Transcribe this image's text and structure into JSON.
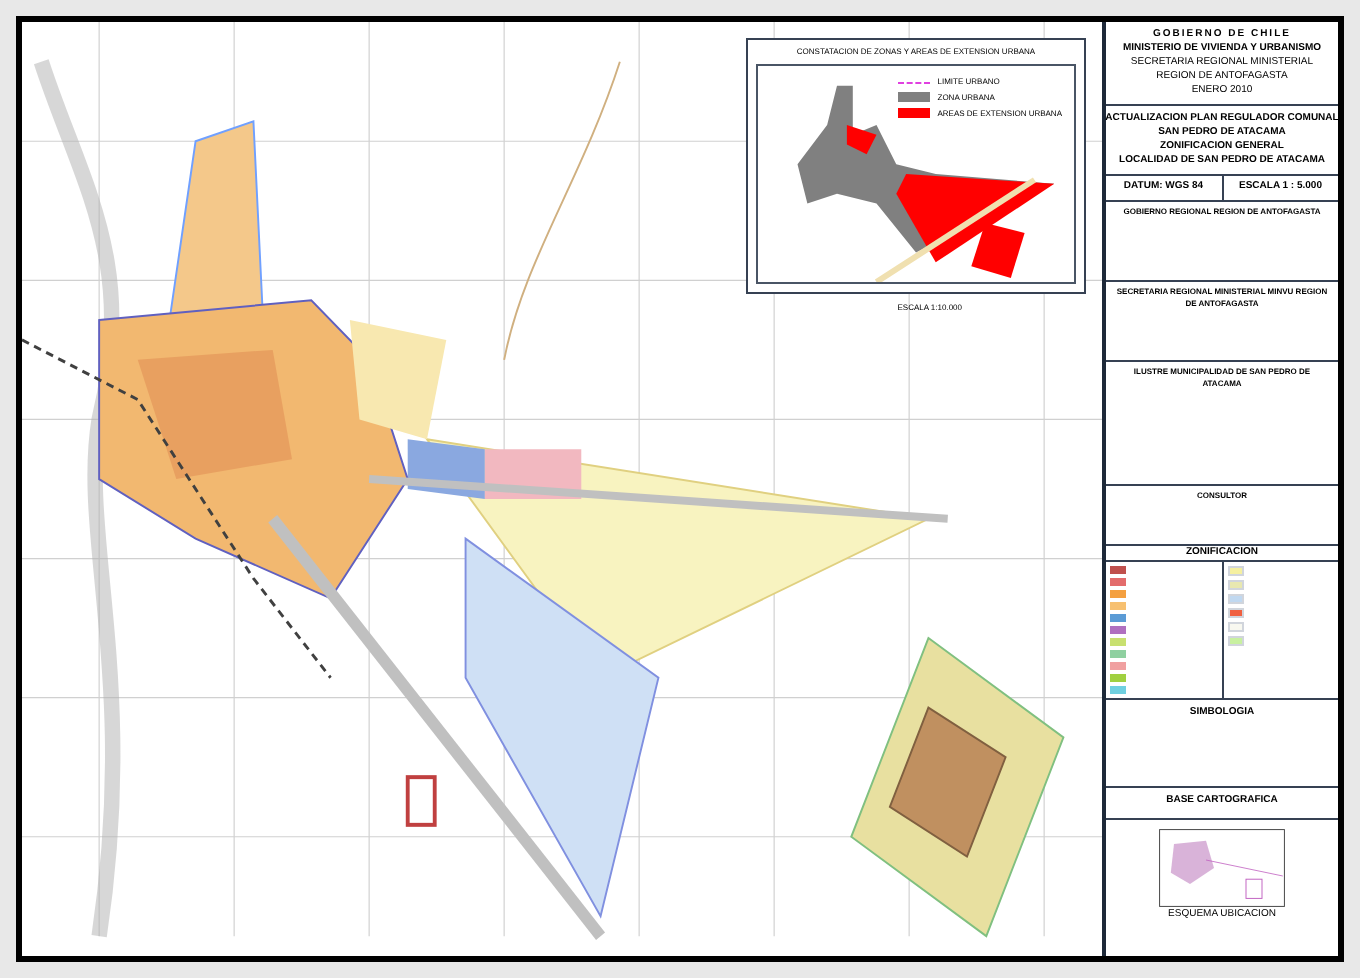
{
  "inset": {
    "title": "CONSTATACION DE ZONAS Y AREAS DE EXTENSION URBANA",
    "legend": [
      {
        "kind": "line",
        "label": "LIMITE URBANO",
        "color": "#e040e0"
      },
      {
        "kind": "fill",
        "label": "ZONA URBANA",
        "color": "#808080"
      },
      {
        "kind": "fill",
        "label": "AREAS DE EXTENSION URBANA",
        "color": "#ff0000"
      }
    ]
  },
  "scale_note": "ESCALA 1:10.000",
  "title_block": {
    "header": [
      "GOBIERNO DE CHILE",
      "MINISTERIO DE VIVIENDA Y URBANISMO",
      "SECRETARIA REGIONAL MINISTERIAL",
      "REGION DE ANTOFAGASTA",
      "ENERO 2010"
    ],
    "project": [
      "ACTUALIZACION PLAN REGULADOR COMUNAL",
      "SAN PEDRO DE ATACAMA",
      "ZONIFICACION GENERAL",
      "LOCALIDAD DE SAN PEDRO DE ATACAMA"
    ],
    "datum": "DATUM: WGS 84",
    "scale": "ESCALA 1 : 5.000",
    "sections": [
      "GOBIERNO REGIONAL REGION DE ANTOFAGASTA",
      "SECRETARIA REGIONAL MINISTERIAL MINVU REGION DE ANTOFAGASTA",
      "ILUSTRE MUNICIPALIDAD DE SAN PEDRO DE ATACAMA",
      "CONSULTOR"
    ],
    "zoning_title": "ZONIFICACION",
    "zones": [
      {
        "color": "#c0504d"
      },
      {
        "color": "#e36c6c"
      },
      {
        "color": "#f4a040"
      },
      {
        "color": "#f7c070"
      },
      {
        "color": "#5b9bd5"
      },
      {
        "color": "#b070c0"
      },
      {
        "color": "#c8e070"
      },
      {
        "color": "#8fd0a0"
      },
      {
        "color": "#f0a0a0"
      },
      {
        "color": "#a0d040"
      },
      {
        "color": "#70d0e0"
      }
    ],
    "zones_right": [
      {
        "color": "#f5f0a0"
      },
      {
        "color": "#e8e8b0"
      },
      {
        "color": "#c0d8f0"
      },
      {
        "color": "#f06040"
      },
      {
        "color": "#f8f8f0"
      },
      {
        "color": "#c8f0a0"
      }
    ],
    "symbology_title": "SIMBOLOGIA",
    "base_title": "BASE CARTOGRAFICA",
    "location_title": "ESQUEMA UBICACION"
  }
}
